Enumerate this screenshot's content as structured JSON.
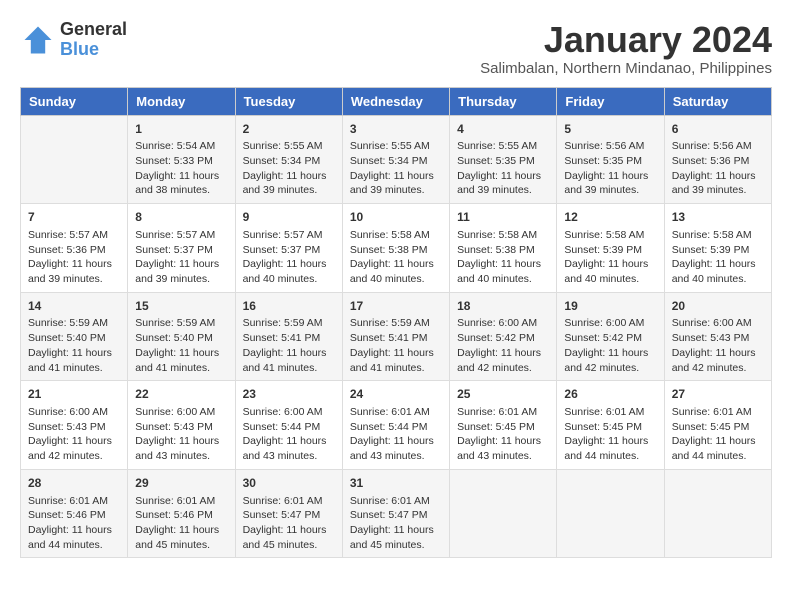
{
  "header": {
    "logo_line1": "General",
    "logo_line2": "Blue",
    "title": "January 2024",
    "subtitle": "Salimbalan, Northern Mindanao, Philippines"
  },
  "days_of_week": [
    "Sunday",
    "Monday",
    "Tuesday",
    "Wednesday",
    "Thursday",
    "Friday",
    "Saturday"
  ],
  "weeks": [
    [
      {
        "day": "",
        "info": ""
      },
      {
        "day": "1",
        "info": "Sunrise: 5:54 AM\nSunset: 5:33 PM\nDaylight: 11 hours\nand 38 minutes."
      },
      {
        "day": "2",
        "info": "Sunrise: 5:55 AM\nSunset: 5:34 PM\nDaylight: 11 hours\nand 39 minutes."
      },
      {
        "day": "3",
        "info": "Sunrise: 5:55 AM\nSunset: 5:34 PM\nDaylight: 11 hours\nand 39 minutes."
      },
      {
        "day": "4",
        "info": "Sunrise: 5:55 AM\nSunset: 5:35 PM\nDaylight: 11 hours\nand 39 minutes."
      },
      {
        "day": "5",
        "info": "Sunrise: 5:56 AM\nSunset: 5:35 PM\nDaylight: 11 hours\nand 39 minutes."
      },
      {
        "day": "6",
        "info": "Sunrise: 5:56 AM\nSunset: 5:36 PM\nDaylight: 11 hours\nand 39 minutes."
      }
    ],
    [
      {
        "day": "7",
        "info": "Sunrise: 5:57 AM\nSunset: 5:36 PM\nDaylight: 11 hours\nand 39 minutes."
      },
      {
        "day": "8",
        "info": "Sunrise: 5:57 AM\nSunset: 5:37 PM\nDaylight: 11 hours\nand 39 minutes."
      },
      {
        "day": "9",
        "info": "Sunrise: 5:57 AM\nSunset: 5:37 PM\nDaylight: 11 hours\nand 40 minutes."
      },
      {
        "day": "10",
        "info": "Sunrise: 5:58 AM\nSunset: 5:38 PM\nDaylight: 11 hours\nand 40 minutes."
      },
      {
        "day": "11",
        "info": "Sunrise: 5:58 AM\nSunset: 5:38 PM\nDaylight: 11 hours\nand 40 minutes."
      },
      {
        "day": "12",
        "info": "Sunrise: 5:58 AM\nSunset: 5:39 PM\nDaylight: 11 hours\nand 40 minutes."
      },
      {
        "day": "13",
        "info": "Sunrise: 5:58 AM\nSunset: 5:39 PM\nDaylight: 11 hours\nand 40 minutes."
      }
    ],
    [
      {
        "day": "14",
        "info": "Sunrise: 5:59 AM\nSunset: 5:40 PM\nDaylight: 11 hours\nand 41 minutes."
      },
      {
        "day": "15",
        "info": "Sunrise: 5:59 AM\nSunset: 5:40 PM\nDaylight: 11 hours\nand 41 minutes."
      },
      {
        "day": "16",
        "info": "Sunrise: 5:59 AM\nSunset: 5:41 PM\nDaylight: 11 hours\nand 41 minutes."
      },
      {
        "day": "17",
        "info": "Sunrise: 5:59 AM\nSunset: 5:41 PM\nDaylight: 11 hours\nand 41 minutes."
      },
      {
        "day": "18",
        "info": "Sunrise: 6:00 AM\nSunset: 5:42 PM\nDaylight: 11 hours\nand 42 minutes."
      },
      {
        "day": "19",
        "info": "Sunrise: 6:00 AM\nSunset: 5:42 PM\nDaylight: 11 hours\nand 42 minutes."
      },
      {
        "day": "20",
        "info": "Sunrise: 6:00 AM\nSunset: 5:43 PM\nDaylight: 11 hours\nand 42 minutes."
      }
    ],
    [
      {
        "day": "21",
        "info": "Sunrise: 6:00 AM\nSunset: 5:43 PM\nDaylight: 11 hours\nand 42 minutes."
      },
      {
        "day": "22",
        "info": "Sunrise: 6:00 AM\nSunset: 5:43 PM\nDaylight: 11 hours\nand 43 minutes."
      },
      {
        "day": "23",
        "info": "Sunrise: 6:00 AM\nSunset: 5:44 PM\nDaylight: 11 hours\nand 43 minutes."
      },
      {
        "day": "24",
        "info": "Sunrise: 6:01 AM\nSunset: 5:44 PM\nDaylight: 11 hours\nand 43 minutes."
      },
      {
        "day": "25",
        "info": "Sunrise: 6:01 AM\nSunset: 5:45 PM\nDaylight: 11 hours\nand 43 minutes."
      },
      {
        "day": "26",
        "info": "Sunrise: 6:01 AM\nSunset: 5:45 PM\nDaylight: 11 hours\nand 44 minutes."
      },
      {
        "day": "27",
        "info": "Sunrise: 6:01 AM\nSunset: 5:45 PM\nDaylight: 11 hours\nand 44 minutes."
      }
    ],
    [
      {
        "day": "28",
        "info": "Sunrise: 6:01 AM\nSunset: 5:46 PM\nDaylight: 11 hours\nand 44 minutes."
      },
      {
        "day": "29",
        "info": "Sunrise: 6:01 AM\nSunset: 5:46 PM\nDaylight: 11 hours\nand 45 minutes."
      },
      {
        "day": "30",
        "info": "Sunrise: 6:01 AM\nSunset: 5:47 PM\nDaylight: 11 hours\nand 45 minutes."
      },
      {
        "day": "31",
        "info": "Sunrise: 6:01 AM\nSunset: 5:47 PM\nDaylight: 11 hours\nand 45 minutes."
      },
      {
        "day": "",
        "info": ""
      },
      {
        "day": "",
        "info": ""
      },
      {
        "day": "",
        "info": ""
      }
    ]
  ]
}
